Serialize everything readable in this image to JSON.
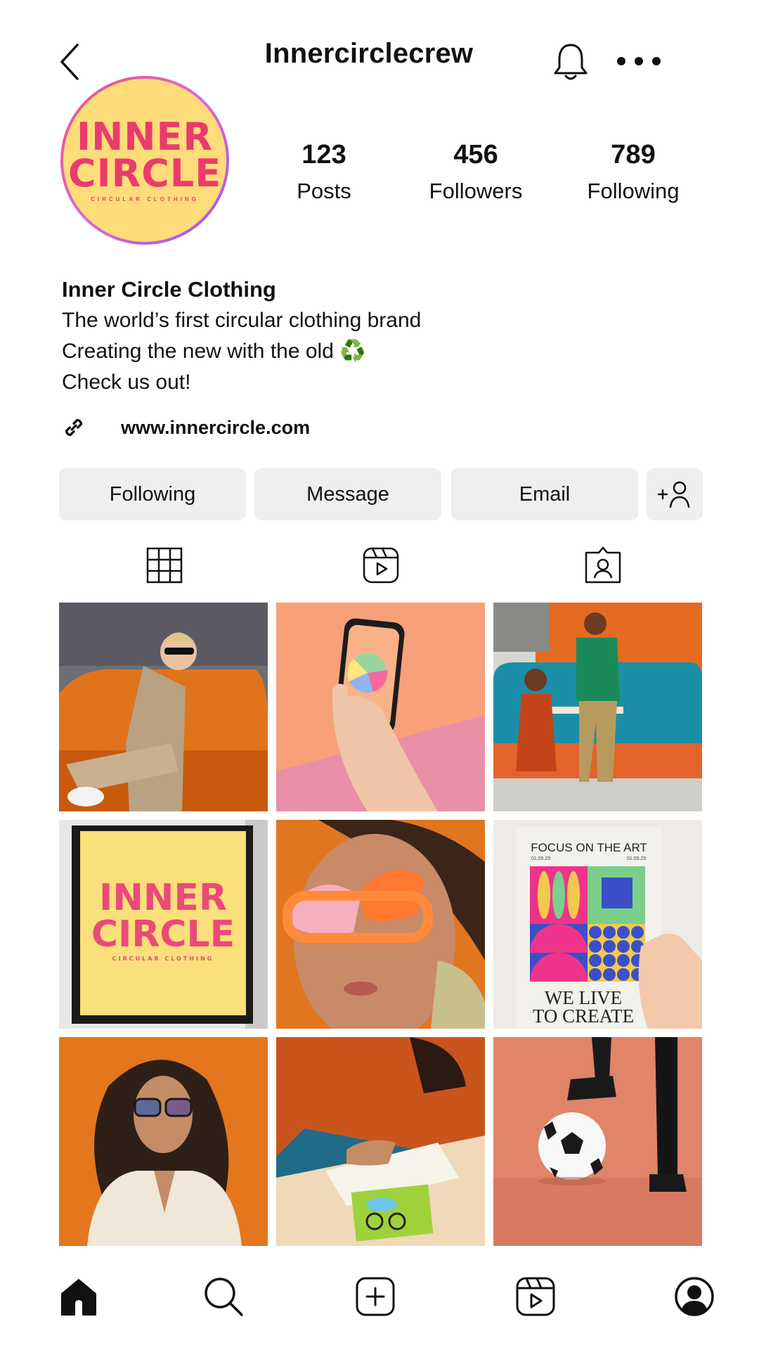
{
  "header": {
    "username": "Innercirclecrew",
    "back_icon": "chevron-left-icon",
    "bell_icon": "bell-icon",
    "more_icon": "more-dots-icon"
  },
  "avatar": {
    "line1": "INNER",
    "line2": "CIRCLE",
    "tagline": "CIRCULAR CLOTHING"
  },
  "stats": [
    {
      "value": "123",
      "label": "Posts"
    },
    {
      "value": "456",
      "label": "Followers"
    },
    {
      "value": "789",
      "label": "Following"
    }
  ],
  "bio": {
    "name": "Inner Circle Clothing",
    "line1": "The world’s first circular clothing brand",
    "line2": "Creating the new with the old ♻️",
    "line3": "Check us out!",
    "link": "www.innercircle.com"
  },
  "actions": {
    "following": "Following",
    "message": "Message",
    "email": "Email"
  },
  "tabs": [
    "grid-icon",
    "reels-icon",
    "tagged-icon"
  ],
  "posts": {
    "sign_line1": "INNER",
    "sign_line2": "CIRCLE",
    "sign_tagline": "CIRCULAR CLOTHING",
    "poster_title": "FOCUS ON THE ART",
    "poster_date1": "01.05.25",
    "poster_date2": "01.05.25",
    "poster_bottom1": "WE LIVE",
    "poster_bottom2": "TO CREATE"
  },
  "colors": {
    "avatar_bg": "#ffdc7a",
    "brand_pink": "#ea3b6c",
    "button_bg": "#efefef"
  },
  "nav": [
    "home-icon",
    "search-icon",
    "create-icon",
    "reels-icon",
    "profile-icon"
  ]
}
